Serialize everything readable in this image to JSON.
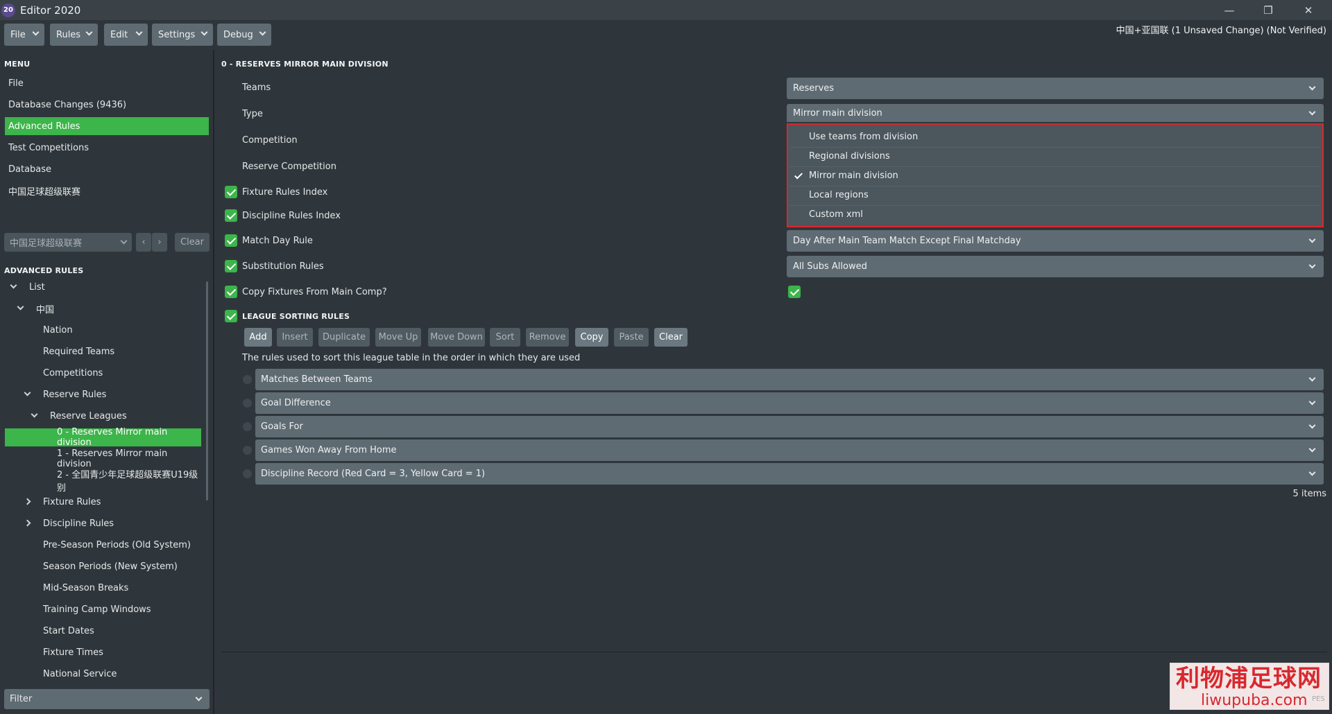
{
  "app": {
    "icon_text": "20",
    "title": "Editor 2020"
  },
  "window_controls": {
    "minimize": "—",
    "maximize": "❐",
    "close": "✕"
  },
  "toolbar": [
    {
      "label": "File"
    },
    {
      "label": "Rules"
    },
    {
      "label": "Edit"
    },
    {
      "label": "Settings"
    },
    {
      "label": "Debug"
    }
  ],
  "status": "中国+亚国联 (1 Unsaved Change) (Not Verified)",
  "sidebar": {
    "menu_heading": "MENU",
    "menu_items": [
      {
        "label": "File"
      },
      {
        "label": "Database Changes (9436)"
      },
      {
        "label": "Advanced Rules",
        "active": true
      },
      {
        "label": "Test Competitions"
      },
      {
        "label": "Database"
      },
      {
        "label": "中国足球超级联赛"
      }
    ],
    "selector": {
      "value": "中国足球超级联赛",
      "clear_label": "Clear"
    },
    "rules_heading": "ADVANCED RULES",
    "tree": [
      {
        "label": "List",
        "expand": "down"
      },
      {
        "label": "中国",
        "expand": "down"
      },
      {
        "label": "Nation"
      },
      {
        "label": "Required Teams"
      },
      {
        "label": "Competitions"
      },
      {
        "label": "Reserve Rules",
        "expand": "down"
      },
      {
        "label": "Reserve Leagues",
        "expand": "down"
      },
      {
        "label": "0 - Reserves Mirror main division",
        "active": true
      },
      {
        "label": "1 - Reserves Mirror main division"
      },
      {
        "label": "2 - 全国青少年足球超级联赛U19级别"
      },
      {
        "label": "Fixture Rules",
        "expand": "right"
      },
      {
        "label": "Discipline Rules",
        "expand": "right"
      },
      {
        "label": "Pre-Season Periods (Old System)"
      },
      {
        "label": "Season Periods (New System)"
      },
      {
        "label": "Mid-Season Breaks"
      },
      {
        "label": "Training Camp Windows"
      },
      {
        "label": "Start Dates"
      },
      {
        "label": "Fixture Times"
      },
      {
        "label": "National Service"
      }
    ],
    "filter": "Filter"
  },
  "main": {
    "title": "0 - RESERVES MIRROR MAIN DIVISION",
    "fields": {
      "teams": {
        "label": "Teams",
        "value": "Reserves"
      },
      "type": {
        "label": "Type",
        "value": "Mirror main division"
      },
      "competition": {
        "label": "Competition"
      },
      "reserve_competition": {
        "label": "Reserve Competition"
      },
      "fixture_rules_index": {
        "label": "Fixture Rules Index",
        "checked": true
      },
      "discipline_rules_index": {
        "label": "Discipline Rules Index",
        "checked": true
      },
      "match_day_rule": {
        "label": "Match Day Rule",
        "checked": true,
        "value": "Day After Main Team Match Except Final Matchday"
      },
      "substitution_rules": {
        "label": "Substitution Rules",
        "checked": true,
        "value": "All Subs Allowed"
      },
      "copy_fixtures": {
        "label": "Copy Fixtures From Main Comp?",
        "checked": true,
        "value_checked": true
      }
    },
    "type_options": [
      {
        "label": "Use teams from division"
      },
      {
        "label": "Regional divisions"
      },
      {
        "label": "Mirror main division",
        "selected": true
      },
      {
        "label": "Local regions"
      },
      {
        "label": "Custom xml"
      }
    ],
    "sorting": {
      "heading": "LEAGUE SORTING RULES",
      "checked": true,
      "buttons": [
        {
          "label": "Add",
          "enabled": true
        },
        {
          "label": "Insert",
          "enabled": false
        },
        {
          "label": "Duplicate",
          "enabled": false
        },
        {
          "label": "Move Up",
          "enabled": false
        },
        {
          "label": "Move Down",
          "enabled": false
        },
        {
          "label": "Sort",
          "enabled": false
        },
        {
          "label": "Remove",
          "enabled": false
        },
        {
          "label": "Copy",
          "enabled": true
        },
        {
          "label": "Paste",
          "enabled": false
        },
        {
          "label": "Clear",
          "enabled": true
        }
      ],
      "description": "The rules used to sort this league table in the order in which they are used",
      "rules": [
        "Matches Between Teams",
        "Goal Difference",
        "Goals For",
        "Games Won Away From Home",
        "Discipline Record (Red Card = 3, Yellow Card = 1)"
      ],
      "count": "5 items"
    }
  },
  "watermark": {
    "line1": "利物浦足球网",
    "line2": "liwupuba.com",
    "tag": "PES"
  },
  "colors": {
    "accent": "#3cb54a",
    "highlight_border": "#e0252b",
    "panel": "#2f363b",
    "control": "#5f6b73"
  }
}
